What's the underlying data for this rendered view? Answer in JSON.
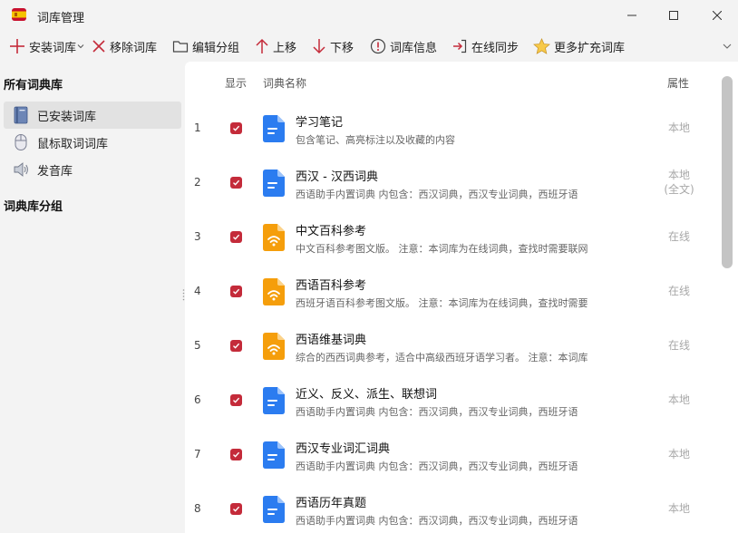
{
  "window": {
    "title": "词库管理",
    "controls": [
      "minimize",
      "maximize",
      "close"
    ]
  },
  "toolbar": {
    "install_label": "安装词库",
    "remove_label": "移除词库",
    "edit_group_label": "编辑分组",
    "move_up_label": "上移",
    "move_down_label": "下移",
    "info_label": "词库信息",
    "sync_label": "在线同步",
    "more_label": "更多扩充词库"
  },
  "sidebar": {
    "all_libraries_heading": "所有词典库",
    "items": [
      {
        "label": "已安装词库",
        "icon": "book-icon",
        "active": true
      },
      {
        "label": "鼠标取词词库",
        "icon": "mouse-icon",
        "active": false
      },
      {
        "label": "发音库",
        "icon": "speaker-icon",
        "active": false
      }
    ],
    "groups_heading": "词典库分组"
  },
  "list": {
    "headers": {
      "show": "显示",
      "name": "词典名称",
      "property": "属性"
    },
    "rows": [
      {
        "num": "1",
        "title": "学习笔记",
        "desc": "包含笔记、高亮标注以及收藏的内容",
        "prop": "本地",
        "type": "doc",
        "checked": true
      },
      {
        "num": "2",
        "title": "西汉 - 汉西词典",
        "desc": "西语助手内置词典 内包含：西汉词典，西汉专业词典，西班牙语",
        "prop": "本地\n(全文)",
        "type": "doc",
        "checked": true
      },
      {
        "num": "3",
        "title": "中文百科参考",
        "desc": "中文百科参考图文版。 注意：本词库为在线词典，查找时需要联网",
        "prop": "在线",
        "type": "online",
        "checked": true
      },
      {
        "num": "4",
        "title": "西语百科参考",
        "desc": "西班牙语百科参考图文版。 注意：本词库为在线词典，查找时需要",
        "prop": "在线",
        "type": "online",
        "checked": true
      },
      {
        "num": "5",
        "title": "西语维基词典",
        "desc": "综合的西西词典参考，适合中高级西班牙语学习者。 注意：本词库",
        "prop": "在线",
        "type": "online",
        "checked": true
      },
      {
        "num": "6",
        "title": "近义、反义、派生、联想词",
        "desc": "西语助手内置词典 内包含：西汉词典，西汉专业词典，西班牙语",
        "prop": "本地",
        "type": "doc",
        "checked": true
      },
      {
        "num": "7",
        "title": "西汉专业词汇词典",
        "desc": "西语助手内置词典 内包含：西汉词典，西汉专业词典，西班牙语",
        "prop": "本地",
        "type": "doc",
        "checked": true
      },
      {
        "num": "8",
        "title": "西语历年真题",
        "desc": "西语助手内置词典 内包含：西汉词典，西汉专业词典，西班牙语",
        "prop": "本地",
        "type": "doc",
        "checked": true
      }
    ]
  },
  "colors": {
    "accent_red": "#c42b3a",
    "doc_icon_blue": "#2b7cf0",
    "online_icon_orange": "#f59e0b",
    "sidebar_bg": "#f3f3f3",
    "active_item_bg": "#e2e2e2"
  }
}
